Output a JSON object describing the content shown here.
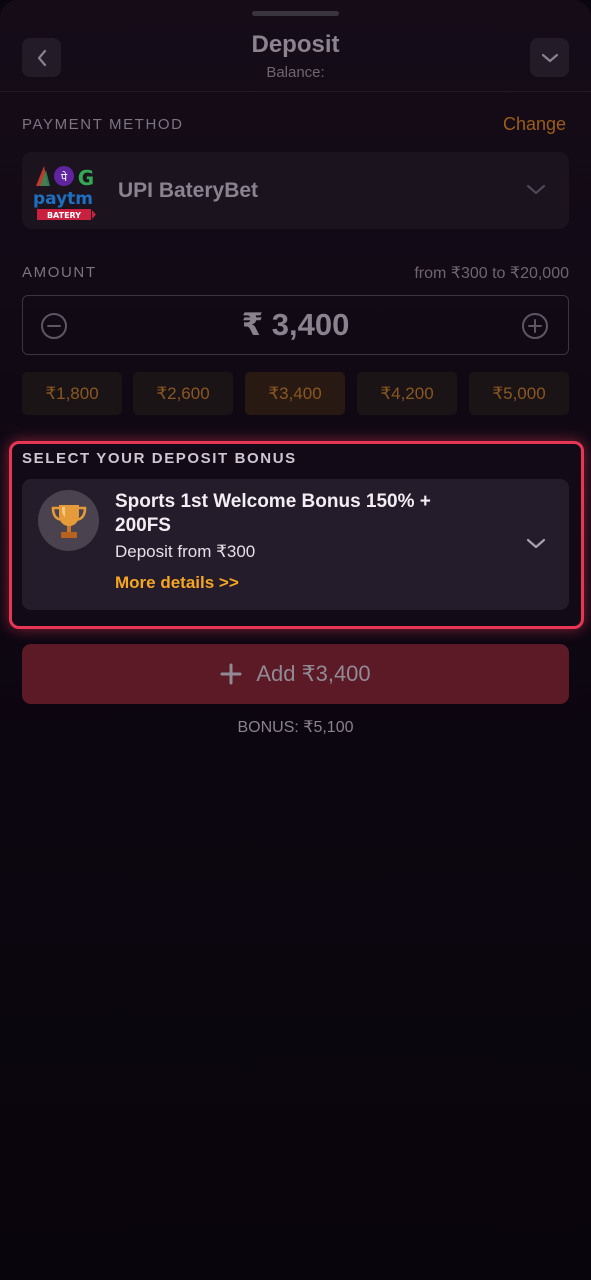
{
  "header": {
    "title": "Deposit",
    "balance_label": "Balance:"
  },
  "payment_method": {
    "section_label": "PAYMENT METHOD",
    "change_label": "Change",
    "selected_name": "UPI BateryBet",
    "logo_text": {
      "brand": "paytm",
      "badge": "BATERY",
      "phonepe_glyph": "पे",
      "google_glyph": "G"
    }
  },
  "amount": {
    "section_label": "AMOUNT",
    "range_text": "from ₹300 to ₹20,000",
    "value": "₹ 3,400",
    "presets": [
      "₹1,800",
      "₹2,600",
      "₹3,400",
      "₹4,200",
      "₹5,000"
    ],
    "selected_preset_index": 2
  },
  "bonus": {
    "section_label": "SELECT YOUR DEPOSIT BONUS",
    "title": "Sports 1st Welcome Bonus 150% + 200FS",
    "min_deposit": "Deposit from ₹300",
    "more_details": "More details >>",
    "icon": "trophy-icon"
  },
  "actions": {
    "add_label": "Add ₹3,400",
    "bonus_total": "BONUS: ₹5,100"
  },
  "colors": {
    "accent_orange": "#f5a623",
    "highlight_red": "#e63654",
    "primary_button": "#5c1a26",
    "background": "#0a0510"
  }
}
